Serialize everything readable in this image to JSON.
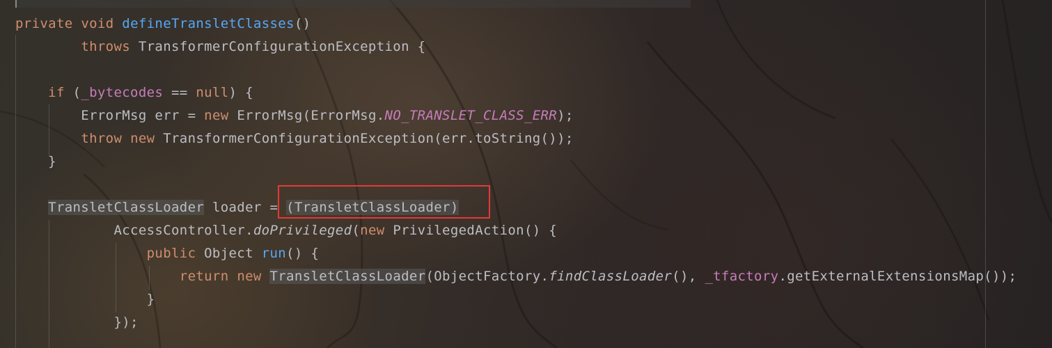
{
  "editor": {
    "theme": "dark",
    "colors": {
      "keyword": "#cf8e6d",
      "method_declaration": "#56a8f5",
      "constant": "#c77dbb",
      "field": "#c77dbb",
      "plain": "#bcbec4",
      "annotation_box": "#e53935"
    },
    "lines": [
      {
        "id": "line-1",
        "tokens": [
          {
            "text": "private",
            "type": "kw"
          },
          {
            "text": " ",
            "type": "plain"
          },
          {
            "text": "void",
            "type": "kw"
          },
          {
            "text": " ",
            "type": "plain"
          },
          {
            "text": "defineTransletClasses",
            "type": "fn"
          },
          {
            "text": "()",
            "type": "plain"
          }
        ]
      },
      {
        "id": "line-2",
        "tokens": [
          {
            "text": "        ",
            "type": "plain"
          },
          {
            "text": "throws",
            "type": "kw"
          },
          {
            "text": " TransformerConfigurationException {",
            "type": "plain"
          }
        ]
      },
      {
        "id": "line-3",
        "tokens": []
      },
      {
        "id": "line-4",
        "tokens": [
          {
            "text": "    ",
            "type": "plain"
          },
          {
            "text": "if",
            "type": "kw"
          },
          {
            "text": " (",
            "type": "plain"
          },
          {
            "text": "_bytecodes",
            "type": "field"
          },
          {
            "text": " == ",
            "type": "plain"
          },
          {
            "text": "null",
            "type": "kw"
          },
          {
            "text": ") {",
            "type": "plain"
          }
        ]
      },
      {
        "id": "line-5",
        "tokens": [
          {
            "text": "        ErrorMsg err = ",
            "type": "plain"
          },
          {
            "text": "new",
            "type": "kw"
          },
          {
            "text": " ErrorMsg(ErrorMsg.",
            "type": "plain"
          },
          {
            "text": "NO_TRANSLET_CLASS_ERR",
            "type": "const"
          },
          {
            "text": ");",
            "type": "plain"
          }
        ]
      },
      {
        "id": "line-6",
        "tokens": [
          {
            "text": "        ",
            "type": "plain"
          },
          {
            "text": "throw",
            "type": "kw"
          },
          {
            "text": " ",
            "type": "plain"
          },
          {
            "text": "new",
            "type": "kw"
          },
          {
            "text": " TransformerConfigurationException(err.toString());",
            "type": "plain"
          }
        ]
      },
      {
        "id": "line-7",
        "tokens": [
          {
            "text": "    }",
            "type": "plain"
          }
        ]
      },
      {
        "id": "line-8",
        "tokens": []
      },
      {
        "id": "line-9",
        "tokens": [
          {
            "text": "    ",
            "type": "plain"
          },
          {
            "text": "TransletClassLoader",
            "type": "hl"
          },
          {
            "text": " loader = ",
            "type": "plain"
          },
          {
            "text": "(TransletClassLoader)",
            "type": "hl"
          }
        ]
      },
      {
        "id": "line-10",
        "tokens": [
          {
            "text": "            AccessController.",
            "type": "plain"
          },
          {
            "text": "doPrivileged",
            "type": "static-call"
          },
          {
            "text": "(",
            "type": "plain"
          },
          {
            "text": "new",
            "type": "kw"
          },
          {
            "text": " PrivilegedAction() {",
            "type": "plain"
          }
        ]
      },
      {
        "id": "line-11",
        "tokens": [
          {
            "text": "                ",
            "type": "plain"
          },
          {
            "text": "public",
            "type": "kw"
          },
          {
            "text": " Object ",
            "type": "plain"
          },
          {
            "text": "run",
            "type": "fn"
          },
          {
            "text": "() {",
            "type": "plain"
          }
        ]
      },
      {
        "id": "line-12",
        "tokens": [
          {
            "text": "                    ",
            "type": "plain"
          },
          {
            "text": "return",
            "type": "kw"
          },
          {
            "text": " ",
            "type": "plain"
          },
          {
            "text": "new",
            "type": "kw"
          },
          {
            "text": " ",
            "type": "plain"
          },
          {
            "text": "TransletClassLoader",
            "type": "hl"
          },
          {
            "text": "(ObjectFactory.",
            "type": "plain"
          },
          {
            "text": "findClassLoader",
            "type": "static-call"
          },
          {
            "text": "(), ",
            "type": "plain"
          },
          {
            "text": "_tfactory",
            "type": "field"
          },
          {
            "text": ".getExternalExtensionsMap());",
            "type": "plain"
          }
        ]
      },
      {
        "id": "line-13",
        "tokens": [
          {
            "text": "                }",
            "type": "plain"
          }
        ]
      },
      {
        "id": "line-14",
        "tokens": [
          {
            "text": "            });",
            "type": "plain"
          }
        ]
      }
    ]
  }
}
